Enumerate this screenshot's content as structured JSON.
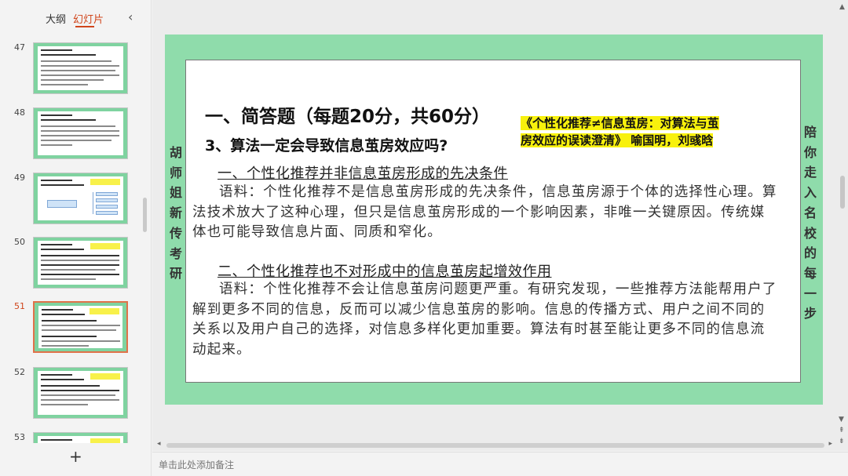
{
  "panel": {
    "tab_outline": "大纲",
    "tab_slides": "幻灯片",
    "collapse_icon": "chevron-left-icon",
    "add_label": "+",
    "thumbnails": [
      {
        "number": "47"
      },
      {
        "number": "48"
      },
      {
        "number": "49"
      },
      {
        "number": "50"
      },
      {
        "number": "51"
      },
      {
        "number": "52"
      },
      {
        "number": "53"
      }
    ],
    "active_slide": "51"
  },
  "slide": {
    "side_left": [
      "胡",
      "师",
      "姐",
      "新",
      "传",
      "考",
      "研"
    ],
    "side_right": [
      "陪",
      "你",
      "走",
      "入",
      "名",
      "校",
      "的",
      "每",
      "一",
      "步"
    ],
    "title": "一、简答题（每题20分，共60分）",
    "question": "3、算法一定会导致信息茧房效应吗?",
    "reference_line1": "《个性化推荐≠信息茧房：对算法与茧",
    "reference_line2": "房效应的误读澄清》 喻国明，刘彧晗",
    "heading1": "一、个性化推荐并非信息茧房形成的先决条件",
    "para1": "语料：个性化推荐不是信息茧房形成的先决条件，信息茧房源于个体的选择性心理。算法技术放大了这种心理，但只是信息茧房形成的一个影响因素，非唯一关键原因。传统媒体也可能导致信息片面、同质和窄化。",
    "heading2": "二、个性化推荐也不对形成中的信息茧房起增效作用",
    "para2": "语料：个性化推荐不会让信息茧房问题更严重。有研究发现，一些推荐方法能帮用户了解到更多不同的信息，反而可以减少信息茧房的影响。信息的传播方式、用户之间不同的关系以及用户自己的选择，对信息多样化更加重要。算法有时甚至能让更多不同的信息流动起来。"
  },
  "notes": {
    "placeholder": "单击此处添加备注"
  },
  "colors": {
    "accent": "#d0451b",
    "slide_border": "#8fdcab",
    "highlight": "#f8f10d"
  }
}
